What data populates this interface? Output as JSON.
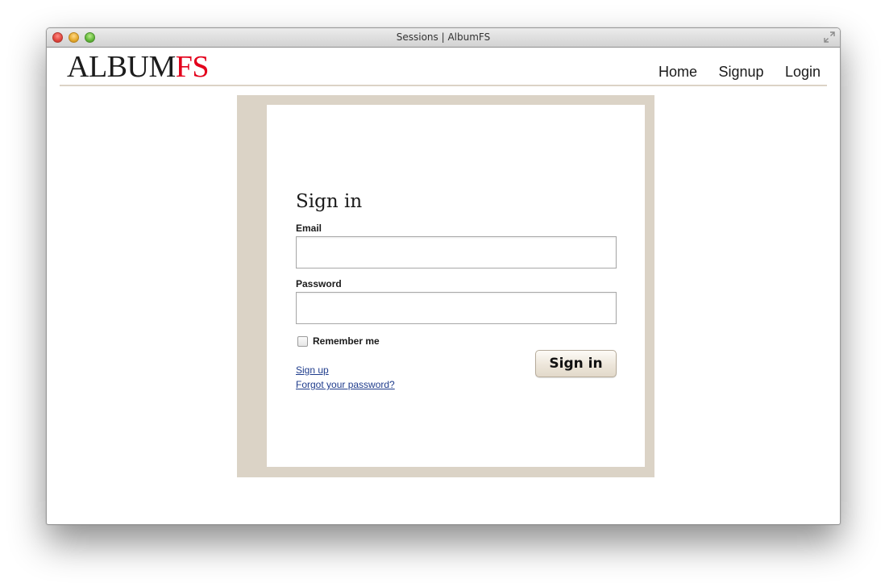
{
  "window": {
    "title": "Sessions | AlbumFS"
  },
  "header": {
    "logo_main": "ALBUM",
    "logo_accent": "FS",
    "nav": [
      {
        "label": "Home"
      },
      {
        "label": "Signup"
      },
      {
        "label": "Login"
      }
    ]
  },
  "form": {
    "title": "Sign in",
    "email_label": "Email",
    "email_value": "",
    "password_label": "Password",
    "password_value": "",
    "remember_label": "Remember me",
    "remember_checked": false,
    "signup_link": "Sign up",
    "forgot_link": "Forgot your password?",
    "submit_label": "Sign in"
  },
  "colors": {
    "brand_accent": "#e3001b",
    "frame_bg": "#dbd3c6",
    "link": "#1f3c8c"
  }
}
